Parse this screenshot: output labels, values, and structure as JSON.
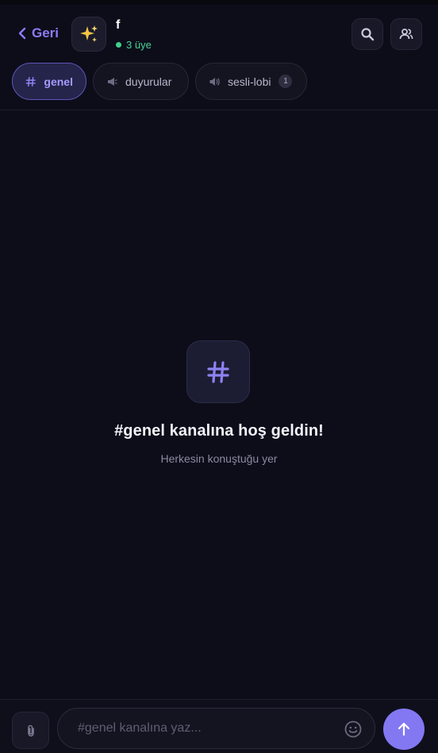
{
  "header": {
    "back_label": "Geri",
    "server_icon": "sparkles-icon",
    "server_name": "f",
    "member_count": "3 üye",
    "search_icon": "search-icon",
    "members_icon": "members-icon"
  },
  "channels": [
    {
      "icon": "hash-icon",
      "label": "genel",
      "active": true
    },
    {
      "icon": "megaphone-icon",
      "label": "duyurular",
      "active": false
    },
    {
      "icon": "speaker-icon",
      "label": "sesli-lobi",
      "active": false,
      "badge": "1"
    }
  ],
  "welcome": {
    "icon": "hash-icon",
    "title": "#genel kanalına hoş geldin!",
    "subtitle": "Herkesin konuştuğu yer"
  },
  "composer": {
    "attach_icon": "paperclip-icon",
    "placeholder": "#genel kanalına yaz...",
    "value": "",
    "emoji_icon": "smiley-icon",
    "send_icon": "arrow-up-icon"
  },
  "colors": {
    "background": "#0d0d1a",
    "accent": "#8378f2",
    "online": "#3fd08a",
    "sparkle": "#f5c542"
  }
}
